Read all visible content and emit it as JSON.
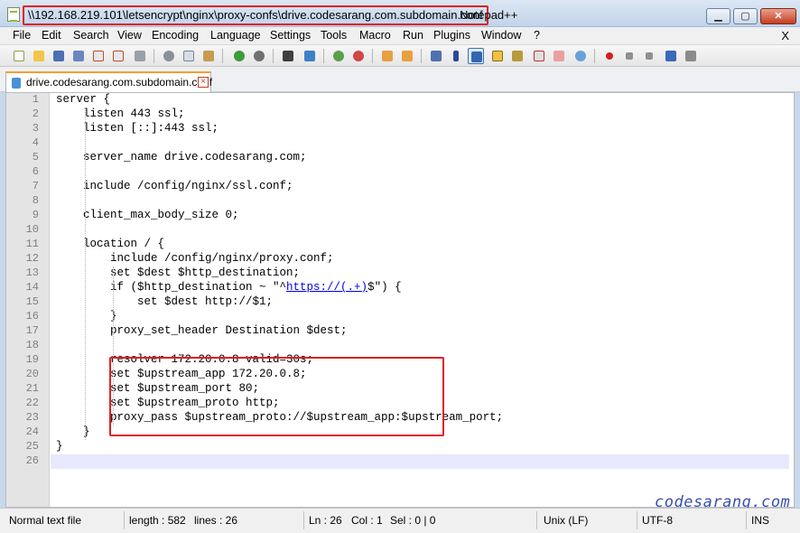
{
  "window": {
    "file_path": "\\\\192.168.219.101\\letsencrypt\\nginx\\proxy-confs\\drive.codesarang.com.subdomain.conf",
    "app_name": "Notepad++",
    "minimize_symbol": "▁",
    "maximize_symbol": "▢",
    "close_symbol": "✕"
  },
  "menu": {
    "items": [
      "File",
      "Edit",
      "Search",
      "View",
      "Encoding",
      "Language",
      "Settings",
      "Tools",
      "Macro",
      "Run",
      "Plugins",
      "Window",
      "?"
    ],
    "close_symbol": "X"
  },
  "toolbar": {
    "icons": [
      "new-file-icon",
      "open-file-icon",
      "save-icon",
      "save-all-icon",
      "close-file-icon",
      "close-all-icon",
      "print-icon",
      "cut-icon",
      "copy-icon",
      "paste-icon",
      "undo-icon",
      "redo-icon",
      "find-icon",
      "replace-icon",
      "zoom-in-icon",
      "zoom-out-icon",
      "sync-vertical-icon",
      "sync-horizontal-icon",
      "word-wrap-icon",
      "show-all-chars-icon",
      "indent-guide-icon",
      "udl-icon",
      "doc-map-icon",
      "function-list-icon",
      "folder-as-workspace-icon",
      "monitoring-icon",
      "record-macro-icon",
      "stop-record-icon",
      "play-macro-icon",
      "run-macro-multiple-icon",
      "save-macro-icon"
    ]
  },
  "tab": {
    "label": "drive.codesarang.com.subdomain.conf",
    "close_symbol": "×"
  },
  "editor": {
    "lines": [
      "server {",
      "    listen 443 ssl;",
      "    listen [::]:443 ssl;",
      "",
      "    server_name drive.codesarang.com;",
      "",
      "    include /config/nginx/ssl.conf;",
      "",
      "    client_max_body_size 0;",
      "",
      "    location / {",
      "        include /config/nginx/proxy.conf;",
      "        set $dest $http_destination;",
      "        if ($http_destination ~ \"^https://(.+)$\") {",
      "            set $dest http://$1;",
      "        }",
      "        proxy_set_header Destination $dest;",
      "",
      "        resolver 172.20.0.8 valid=30s;",
      "        set $upstream_app 172.20.0.8;",
      "        set $upstream_port 80;",
      "        set $upstream_proto http;",
      "        proxy_pass $upstream_proto://$upstream_app:$upstream_port;",
      "    }",
      "}",
      ""
    ],
    "line14_parts": {
      "before": "        if ($http_destination ~ \"^",
      "link": "https://(.+)",
      "after": "$\") {"
    }
  },
  "watermark": "codesarang.com",
  "status": {
    "file_type": "Normal text file",
    "length": "length : 582",
    "lines": "lines : 26",
    "ln": "Ln : 26",
    "col": "Col : 1",
    "sel": "Sel : 0 | 0",
    "eol": "Unix (LF)",
    "encoding": "UTF-8",
    "mode": "INS"
  }
}
